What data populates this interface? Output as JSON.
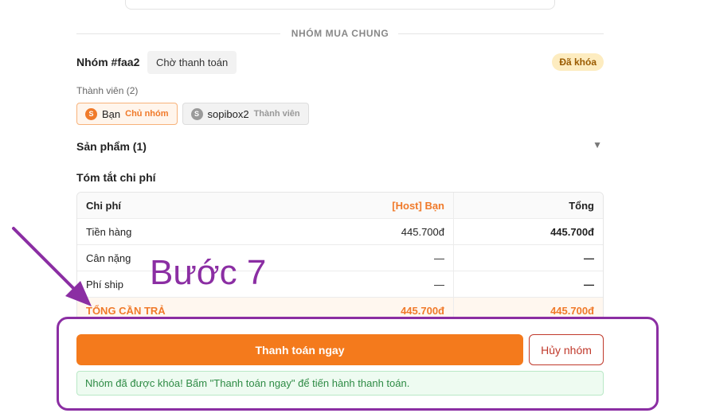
{
  "section": {
    "title": "NHÓM MUA CHUNG"
  },
  "group": {
    "title": "Nhóm #faa2",
    "status": "Chờ thanh toán",
    "lock_badge": "Đã khóa"
  },
  "members": {
    "label": "Thành viên (2)",
    "items": [
      {
        "initial": "S",
        "name": "Bạn",
        "role": "Chủ nhóm"
      },
      {
        "initial": "S",
        "name": "sopibox2",
        "role": "Thành viên"
      }
    ]
  },
  "products": {
    "label": "Sản phẩm (1)",
    "toggle_icon": "▼"
  },
  "summary": {
    "title": "Tóm tắt chi phí",
    "headers": [
      "Chi phí",
      "[Host] Bạn",
      "Tổng"
    ],
    "rows": [
      {
        "label": "Tiền hàng",
        "host": "445.700đ",
        "total": "445.700đ"
      },
      {
        "label": "Cân nặng",
        "host": "—",
        "total": "—"
      },
      {
        "label": "Phí ship",
        "host": "—",
        "total": "—"
      }
    ],
    "total_row": {
      "label": "TỔNG CẦN TRẢ",
      "host": "445.700đ",
      "total": "445.700đ"
    }
  },
  "annotation": {
    "step": "Bước 7",
    "color": "#8b2ea3"
  },
  "actions": {
    "pay_label": "Thanh toán ngay",
    "cancel_label": "Hủy nhóm",
    "notice": "Nhóm đã được khóa! Bấm \"Thanh toán ngay\" để tiến hành thanh toán."
  },
  "colors": {
    "accent": "#f47a1c",
    "danger": "#c0392b",
    "success": "#2e8b45"
  }
}
